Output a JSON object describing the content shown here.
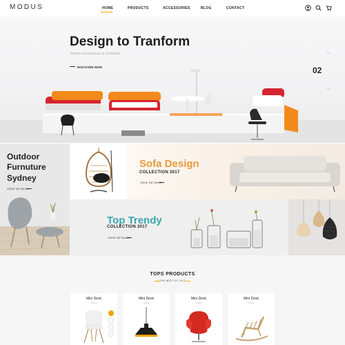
{
  "header": {
    "logo": "MODUS",
    "nav": [
      "HOME",
      "PRODUCTS",
      "ACCESSORIES",
      "BLOG",
      "CONTACT"
    ],
    "active": "HOME",
    "accent_color": "#f2a200"
  },
  "hero": {
    "title": "Design to Tranform",
    "subtitle": "THEIR HOUSEHOLD CHORES",
    "link": "DISCOVER NOW",
    "slide_number": "02",
    "slide_dots": [
      "01",
      "03"
    ]
  },
  "banners": {
    "outdoor": {
      "title_line1": "Outdoor",
      "title_line2": "Furnuture",
      "title_line3": "Sydney",
      "link": "VIEW DETAILS"
    },
    "sofa": {
      "title": "Sofa Design",
      "collection": "COLLECTION 2017",
      "link": "VIEW DETAILS",
      "title_color": "#e89a3c"
    },
    "trendy": {
      "title": "Top Trendy",
      "collection": "COLLECTION 2017",
      "link": "VIEW DETAILS",
      "title_color": "#3aa6b0"
    }
  },
  "products": {
    "title": "TOPS PRODUCTS",
    "subtitle": "THE BEST OF 2017",
    "items": [
      {
        "name": "Mini Desk",
        "category": "Chairs"
      },
      {
        "name": "Mini Desk",
        "category": "Chairs"
      },
      {
        "name": "Mini Desk",
        "category": "Chairs"
      },
      {
        "name": "Mini Desk",
        "category": "Chairs"
      }
    ]
  }
}
